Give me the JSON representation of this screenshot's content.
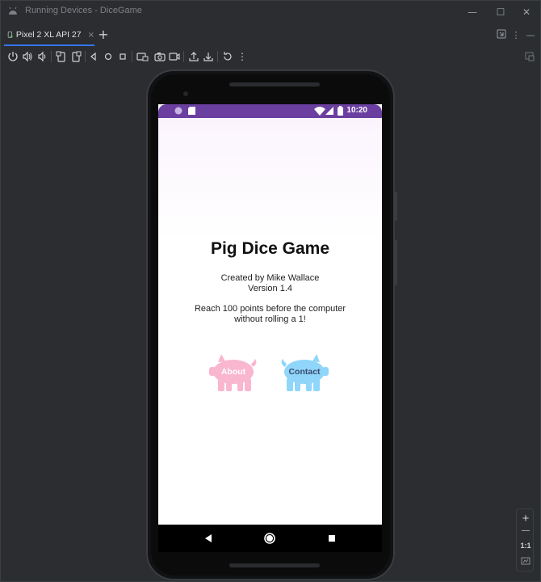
{
  "window": {
    "title": "Running Devices - DiceGame",
    "controls": {
      "minimize": "—",
      "maximize": "☐",
      "close": "✕"
    }
  },
  "tabs": [
    {
      "label": "Pixel 2 XL API 27",
      "close": "×"
    }
  ],
  "tabbar": {
    "add": "+",
    "more": "⋮"
  },
  "toolbar": {
    "icons": [
      "power-icon",
      "volume-up-icon",
      "volume-down-icon",
      "rotate-left-icon",
      "rotate-right-icon",
      "back-icon",
      "home-icon",
      "overview-icon",
      "snapshot-icon",
      "camera-icon",
      "record-icon",
      "upload-icon",
      "download-icon",
      "reset-icon",
      "more-icon"
    ],
    "more": "⋮"
  },
  "device": {
    "status_time": "10:20",
    "app": {
      "title": "Pig Dice Game",
      "credit_line1": "Created by Mike Wallace",
      "credit_line2": "Version 1.4",
      "description": "Reach 100 points before the computer without rolling a 1!",
      "about_label": "About",
      "contact_label": "Contact",
      "about_color": "#f9b6cf",
      "contact_color": "#90d6fb"
    }
  },
  "zoom": {
    "zoom_in": "+",
    "zoom_out": "—",
    "actual_size": "1:1"
  },
  "colors": {
    "status_bar": "#6a3fa0",
    "accent": "#3574f0"
  }
}
